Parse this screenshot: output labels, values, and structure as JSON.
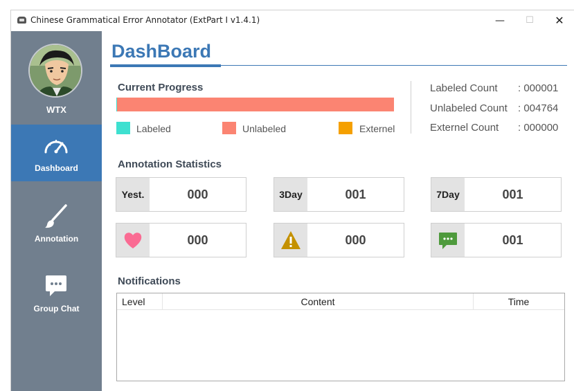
{
  "window": {
    "title": "Chinese Grammatical Error Annotator (ExtPart I v1.4.1)",
    "controls": {
      "minimize": "—",
      "maximize": "☐",
      "close": "✕"
    }
  },
  "sidebar": {
    "user": {
      "name": "WTX"
    },
    "items": [
      {
        "label": "Dashboard",
        "icon": "gauge-icon",
        "active": true
      },
      {
        "label": "Annotation",
        "icon": "brush-icon",
        "active": false
      },
      {
        "label": "Group Chat",
        "icon": "chat-bubble-icon",
        "active": false
      }
    ],
    "colors": {
      "background": "#717f8e",
      "active": "#3c78b5"
    }
  },
  "main": {
    "page_title": "DashBoard",
    "progress": {
      "title": "Current Progress",
      "labeled_fraction": 0.0002,
      "legend": [
        {
          "label": "Labeled",
          "color": "#3ee0d0"
        },
        {
          "label": "Unlabeled",
          "color": "#fb8472"
        },
        {
          "label": "Externel",
          "color": "#f5a000"
        }
      ]
    },
    "counts": [
      {
        "label": "Labeled Count",
        "value": ": 000001"
      },
      {
        "label": "Unlabeled Count",
        "value": ": 004764"
      },
      {
        "label": "Externel Count",
        "value": ": 000000"
      }
    ],
    "statistics": {
      "title": "Annotation Statistics",
      "boxes": [
        {
          "tag": "Yest.",
          "value": "000"
        },
        {
          "tag": "3Day",
          "value": "001"
        },
        {
          "tag": "7Day",
          "value": "001"
        },
        {
          "icon": "heart-icon",
          "value": "000"
        },
        {
          "icon": "warning-icon",
          "value": "000"
        },
        {
          "icon": "chat-bubble-icon",
          "value": "001"
        }
      ]
    },
    "notifications": {
      "title": "Notifications",
      "columns": [
        "Level",
        "Content",
        "Time"
      ],
      "rows": []
    }
  }
}
